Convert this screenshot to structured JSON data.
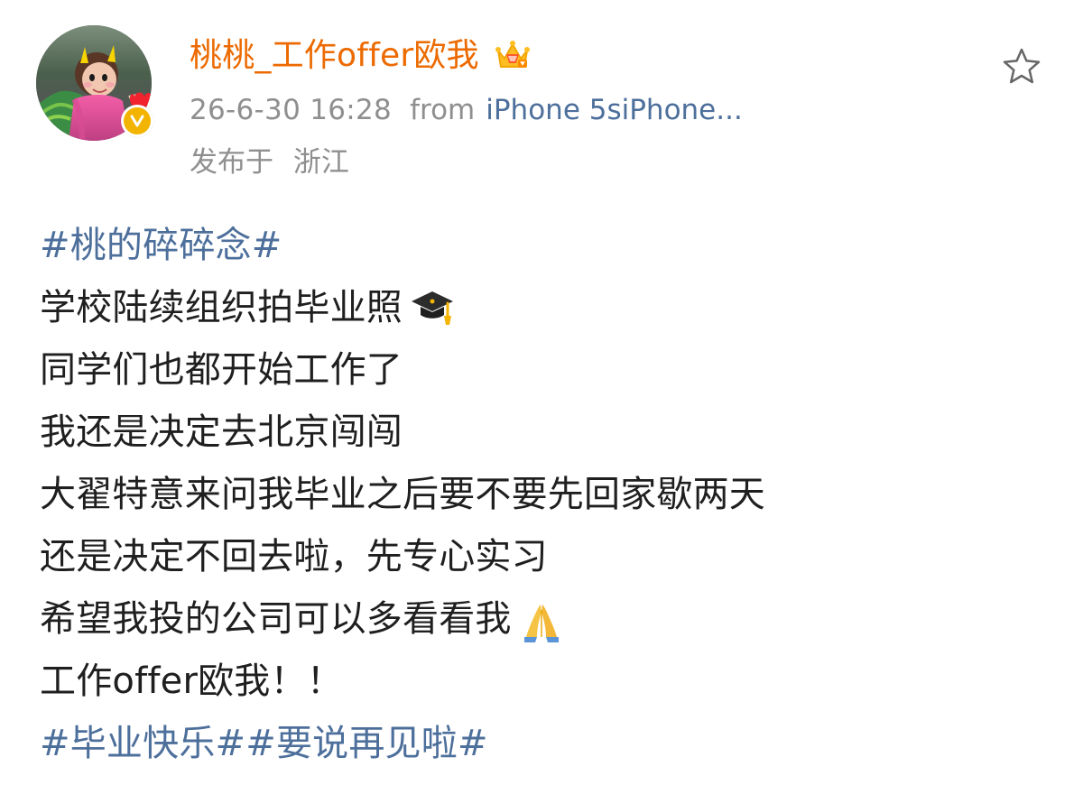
{
  "header": {
    "username": "桃桃_工作offer欧我",
    "timestamp": "26-6-30 16:28",
    "from_label": "from",
    "device": "iPhone 5siPhone",
    "device_ellipsis": "...",
    "location_prefix": "发布于",
    "location": "浙江"
  },
  "post": {
    "topic_top": "#桃的碎碎念#",
    "line1": "学校陆续组织拍毕业照",
    "line2": "同学们也都开始工作了",
    "line3": "我还是决定去北京闯闯",
    "line4": "大翟特意来问我毕业之后要不要先回家歇两天",
    "line5": "还是决定不回去啦，先专心实习",
    "line6": "希望我投的公司可以多看看我",
    "line7": "工作offer欧我！！",
    "topic_bottom_1": "#毕业快乐#",
    "topic_bottom_2": "#要说再见啦#"
  },
  "icons": {
    "crown": "crown-icon",
    "verified": "verified-badge",
    "star": "star-icon",
    "graduation_cap": "graduation-cap-icon",
    "pray": "pray-icon"
  },
  "colors": {
    "username": "#ec6a00",
    "link": "#4d6f9b",
    "meta": "#8f8f8f",
    "text": "#1f1f1f",
    "verified": "#f3b400"
  }
}
